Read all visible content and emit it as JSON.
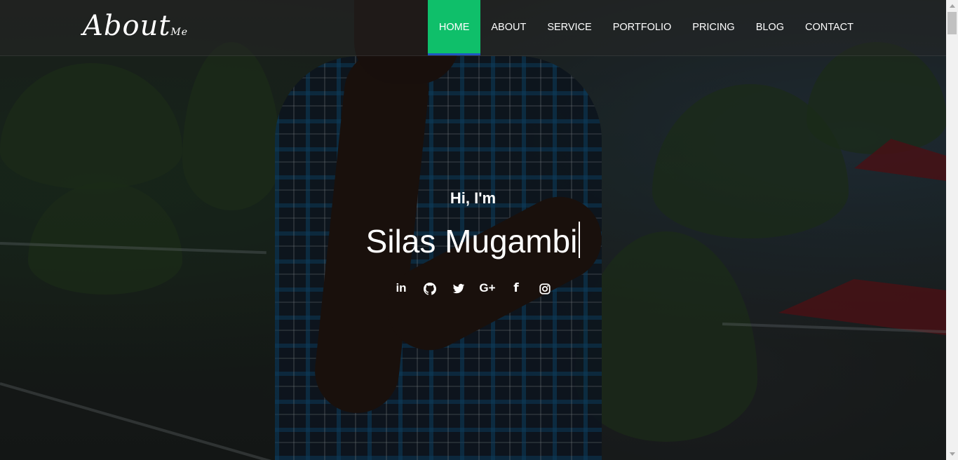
{
  "header": {
    "logo_main": "About",
    "logo_sub": "Me",
    "nav": [
      {
        "label": "HOME",
        "active": true
      },
      {
        "label": "ABOUT",
        "active": false
      },
      {
        "label": "SERVICE",
        "active": false
      },
      {
        "label": "PORTFOLIO",
        "active": false
      },
      {
        "label": "PRICING",
        "active": false
      },
      {
        "label": "BLOG",
        "active": false
      },
      {
        "label": "CONTACT",
        "active": false
      }
    ]
  },
  "hero": {
    "greeting": "Hi, I'm",
    "name": "Silas Mugambi",
    "social": [
      {
        "icon": "linkedin-icon",
        "glyph": "in"
      },
      {
        "icon": "github-icon"
      },
      {
        "icon": "twitter-icon"
      },
      {
        "icon": "google-plus-icon",
        "glyph": "G+"
      },
      {
        "icon": "facebook-icon",
        "glyph": "f"
      },
      {
        "icon": "instagram-icon"
      }
    ]
  },
  "colors": {
    "accent": "#0fbf6a",
    "active_underline": "#1f57c3",
    "text": "#ffffff"
  }
}
